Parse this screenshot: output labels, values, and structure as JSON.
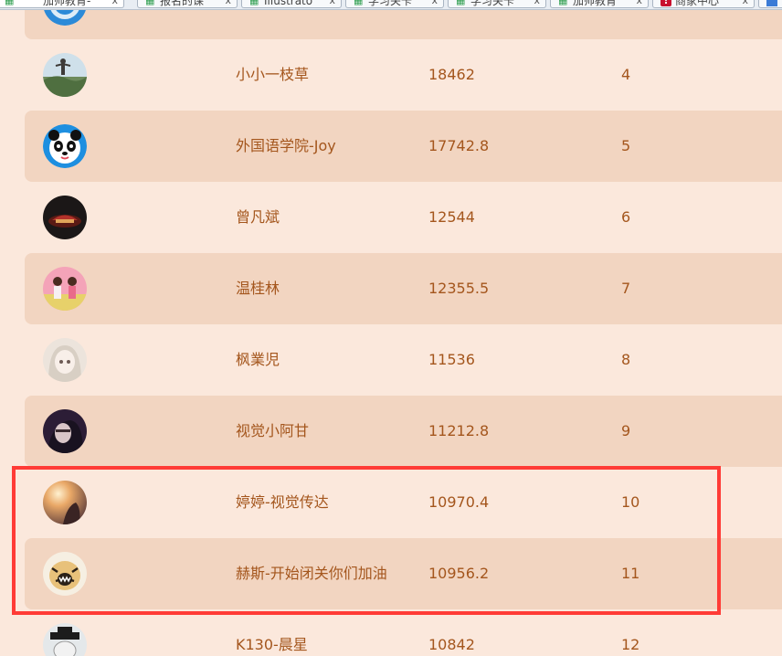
{
  "browser": {
    "tabs": [
      {
        "label": "加帅教育-",
        "active": true,
        "favicon": "grid-favicon"
      },
      {
        "label": "报名的课",
        "active": false,
        "favicon": "grid-favicon"
      },
      {
        "label": "Illustrato",
        "active": false,
        "favicon": "grid-favicon"
      },
      {
        "label": "学习关卡",
        "active": false,
        "favicon": "grid-favicon"
      },
      {
        "label": "学习关卡",
        "active": false,
        "favicon": "grid-favicon"
      },
      {
        "label": "加帅教育",
        "active": false,
        "favicon": "grid-favicon"
      },
      {
        "label": "商家中心",
        "active": false,
        "favicon": "red-favicon"
      }
    ],
    "close_glyph": "x"
  },
  "ranking": {
    "rows": [
      {
        "name": "",
        "score": "",
        "rank": "",
        "avatar": "blue-avatar",
        "partial": true
      },
      {
        "name": "小小一枝草",
        "score": "18462",
        "rank": "4",
        "avatar": "landscape-avatar"
      },
      {
        "name": "外国语学院-Joy",
        "score": "17742.8",
        "rank": "5",
        "avatar": "panda-avatar"
      },
      {
        "name": "曾凡斌",
        "score": "12544",
        "rank": "6",
        "avatar": "dark-car-avatar"
      },
      {
        "name": "温桂林",
        "score": "12355.5",
        "rank": "7",
        "avatar": "girls-avatar"
      },
      {
        "name": "枫業児",
        "score": "11536",
        "rank": "8",
        "avatar": "anime-girl-avatar"
      },
      {
        "name": "视觉小阿甘",
        "score": "11212.8",
        "rank": "9",
        "avatar": "portrait-avatar"
      },
      {
        "name": "婷婷-视觉传达",
        "score": "10970.4",
        "rank": "10",
        "avatar": "sunset-avatar"
      },
      {
        "name": "赫斯-开始闭关你们加油",
        "score": "10956.2",
        "rank": "11",
        "avatar": "tiger-avatar"
      },
      {
        "name": "K130-晨星",
        "score": "10842",
        "rank": "12",
        "avatar": "cartoon-avatar"
      }
    ]
  },
  "colors": {
    "page_background": "#fbe8dc",
    "alt_row_background": "#f2d5c1",
    "text": "#a4561d",
    "highlight_border": "#ff3b36"
  }
}
